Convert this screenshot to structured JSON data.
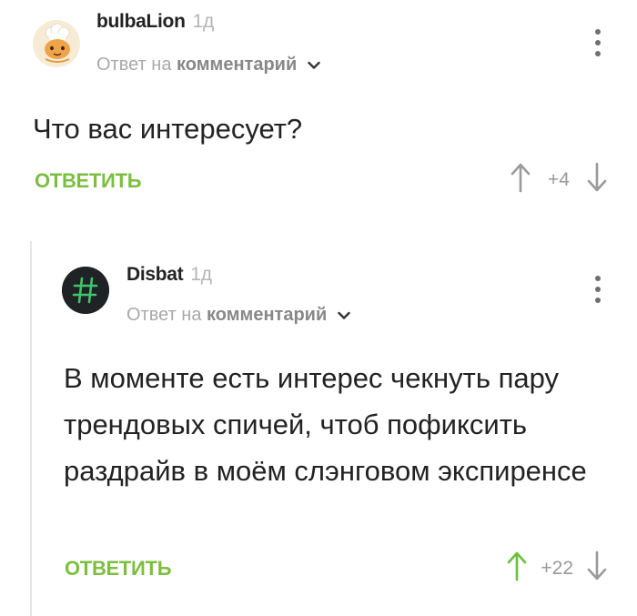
{
  "comments": [
    {
      "username": "bulbaLion",
      "time": "1д",
      "reply_prefix": "Ответ на",
      "reply_link": "комментарий",
      "text": "Что вас интересует?",
      "reply_button": "ОТВЕТИТЬ",
      "rating": "+4",
      "upvoted": false
    },
    {
      "username": "Disbat",
      "time": "1д",
      "reply_prefix": "Ответ на",
      "reply_link": "комментарий",
      "text": "В моменте есть интерес чекнуть пару трендовых спичей, чтоб пофиксить раздрайв в моём слэнговом экспиренсе",
      "reply_button": "ОТВЕТИТЬ",
      "rating": "+22",
      "upvoted": true
    }
  ],
  "colors": {
    "accent_green": "#7bbf3f",
    "upvote_active": "#6abf3c",
    "vote_inactive": "#9a9a9a",
    "avatar2_hash": "#3ec56a"
  },
  "icons": {
    "menu": "more-vertical-icon",
    "expand": "chevron-down-icon",
    "upvote": "arrow-up-icon",
    "downvote": "arrow-down-icon",
    "avatar2": "hash-icon"
  }
}
